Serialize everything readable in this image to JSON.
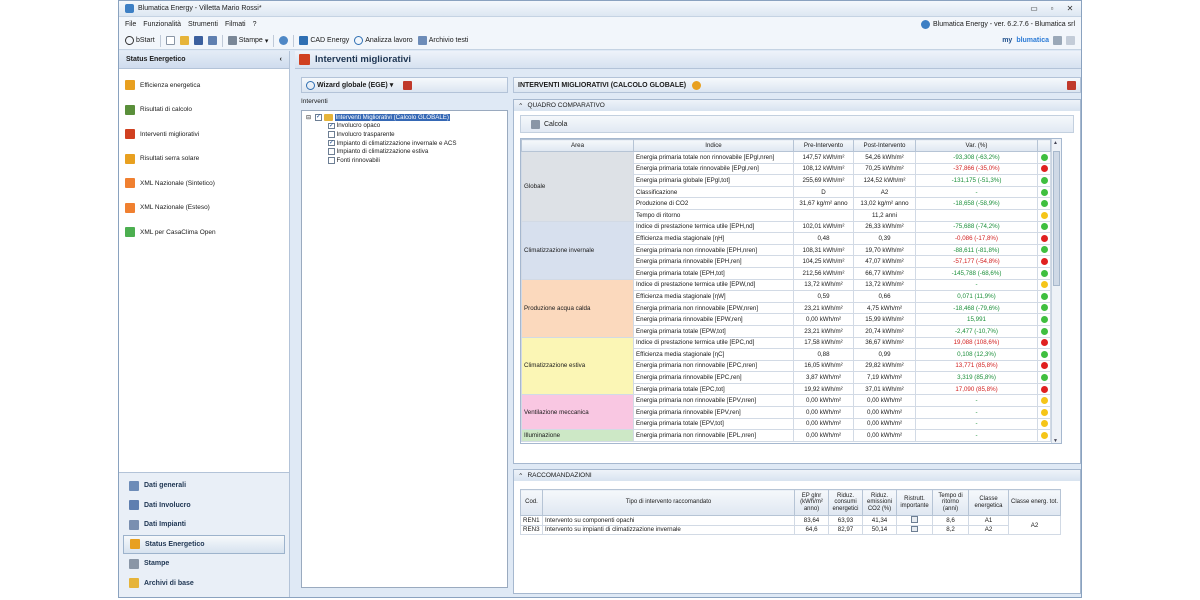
{
  "app": {
    "title": "Blumatica Energy - Villetta Mario Rossi*",
    "version": "Blumatica Energy - ver. 6.2.7.6 - Blumatica srl",
    "menu": [
      "File",
      "Funzionalità",
      "Strumenti",
      "Filmati",
      "?"
    ],
    "toolbar": {
      "bstart": "bStart",
      "stampe": "Stampe",
      "cad": "CAD Energy",
      "analizza": "Analizza lavoro",
      "archivio": "Archivio testi"
    },
    "logo_my": "my",
    "logo_brand": "blumatica"
  },
  "left_panel": {
    "title": "Status Energetico",
    "pin_glyph": "‹",
    "items": [
      {
        "label": "Efficienza energetica",
        "icon_color": "#e8a020"
      },
      {
        "label": "Risultati di calcolo",
        "icon_color": "#5a8f3a"
      },
      {
        "label": "Interventi migliorativi",
        "icon_color": "#d04020"
      },
      {
        "label": "Risultati serra solare",
        "icon_color": "#e8a020"
      },
      {
        "label": "XML Nazionale (Sintetico)",
        "icon_color": "#f08030"
      },
      {
        "label": "XML Nazionale (Esteso)",
        "icon_color": "#f08030"
      },
      {
        "label": "XML per CasaClima Open",
        "icon_color": "#4caf50"
      }
    ],
    "nav": [
      {
        "label": "Dati generali",
        "active": false
      },
      {
        "label": "Dati Involucro",
        "active": false
      },
      {
        "label": "Dati Impianti",
        "active": false
      },
      {
        "label": "Status Energetico",
        "active": true
      },
      {
        "label": "Stampe",
        "active": false
      },
      {
        "label": "Archivi di base",
        "active": false
      }
    ]
  },
  "main": {
    "title": "Interventi migliorativi",
    "wizard_label": "Wizard globale (EGE)",
    "tree_label": "Interventi",
    "tree": [
      {
        "label": "Interventi Migliorativi (Calcolo GLOBALE)",
        "level": 0,
        "checked": true,
        "selected": true
      },
      {
        "label": "Involucro opaco",
        "level": 1,
        "checked": true,
        "selected": false
      },
      {
        "label": "Involucro trasparente",
        "level": 1,
        "checked": false,
        "selected": false
      },
      {
        "label": "Impianto di climatizzazione invernale e ACS",
        "level": 1,
        "checked": true,
        "selected": false
      },
      {
        "label": "Impianto di climatizzazione estiva",
        "level": 1,
        "checked": false,
        "selected": false
      },
      {
        "label": "Fonti rinnovabili",
        "level": 1,
        "checked": false,
        "selected": false
      }
    ],
    "right_title": "INTERVENTI MIGLIORATIVI (CALCOLO GLOBALE)",
    "section1": "QUADRO COMPARATIVO",
    "calcola": "Calcola",
    "columns": [
      "Area",
      "Indice",
      "Pre-Intervento",
      "Post-Intervento",
      "Var. (%)"
    ],
    "colors": {
      "green": "#3fbf3f",
      "red": "#e02020",
      "yellow": "#f5c518",
      "positive": "#1b8f3a",
      "negative": "#d11e1e"
    },
    "groups": [
      {
        "area": "Globale",
        "bg": "#dde1e6",
        "rows": [
          {
            "index": "Energia primaria totale non rinnovabile [EPgl,nren]",
            "pre": "147,57 kWh/m²",
            "post": "54,26 kWh/m²",
            "var": "-93,308 (-63,2%)",
            "tone": "pos",
            "dot": "green"
          },
          {
            "index": "Energia primaria totale rinnovabile [EPgl,ren]",
            "pre": "108,12 kWh/m²",
            "post": "70,25 kWh/m²",
            "var": "-37,866 (-35,0%)",
            "tone": "neg",
            "dot": "red"
          },
          {
            "index": "Energia primaria globale [EPgl,tot]",
            "pre": "255,69 kWh/m²",
            "post": "124,52 kWh/m²",
            "var": "-131,175 (-51,3%)",
            "tone": "pos",
            "dot": "green"
          },
          {
            "index": "Classificazione",
            "pre": "D",
            "post": "A2",
            "var": "-",
            "tone": "pos",
            "dot": "green"
          },
          {
            "index": "Produzione di CO2",
            "pre": "31,67 kg/m² anno",
            "post": "13,02 kg/m² anno",
            "var": "-18,658 (-58,9%)",
            "tone": "pos",
            "dot": "green"
          },
          {
            "index": "Tempo di ritorno",
            "pre": "",
            "post": "11,2 anni",
            "var": "",
            "tone": "pos",
            "dot": "yellow"
          }
        ]
      },
      {
        "area": "Climatizzazione invernale",
        "bg": "#d7e0ee",
        "rows": [
          {
            "index": "Indice di prestazione termica utile [EPH,nd]",
            "pre": "102,01 kWh/m²",
            "post": "26,33 kWh/m²",
            "var": "-75,688 (-74,2%)",
            "tone": "pos",
            "dot": "green"
          },
          {
            "index": "Efficienza media stagionale [ηH]",
            "pre": "0,48",
            "post": "0,39",
            "var": "-0,086 (-17,8%)",
            "tone": "neg",
            "dot": "red"
          },
          {
            "index": "Energia primaria non rinnovabile [EPH,nren]",
            "pre": "108,31 kWh/m²",
            "post": "19,70 kWh/m²",
            "var": "-88,611 (-81,8%)",
            "tone": "pos",
            "dot": "green"
          },
          {
            "index": "Energia primaria rinnovabile [EPH,ren]",
            "pre": "104,25 kWh/m²",
            "post": "47,07 kWh/m²",
            "var": "-57,177 (-54,8%)",
            "tone": "neg",
            "dot": "red"
          },
          {
            "index": "Energia primaria totale [EPH,tot]",
            "pre": "212,56 kWh/m²",
            "post": "66,77 kWh/m²",
            "var": "-145,788 (-68,6%)",
            "tone": "pos",
            "dot": "green"
          }
        ]
      },
      {
        "area": "Produzione acqua calda",
        "bg": "#fbd9bd",
        "rows": [
          {
            "index": "Indice di prestazione termica utile [EPW,nd]",
            "pre": "13,72 kWh/m²",
            "post": "13,72 kWh/m²",
            "var": "-",
            "tone": "pos",
            "dot": "yellow"
          },
          {
            "index": "Efficienza media stagionale [ηW]",
            "pre": "0,59",
            "post": "0,66",
            "var": "0,071 (11,9%)",
            "tone": "pos",
            "dot": "green"
          },
          {
            "index": "Energia primaria non rinnovabile [EPW,nren]",
            "pre": "23,21 kWh/m²",
            "post": "4,75 kWh/m²",
            "var": "-18,468 (-79,6%)",
            "tone": "pos",
            "dot": "green"
          },
          {
            "index": "Energia primaria rinnovabile [EPW,ren]",
            "pre": "0,00 kWh/m²",
            "post": "15,99 kWh/m²",
            "var": "15,991",
            "tone": "pos",
            "dot": "green"
          },
          {
            "index": "Energia primaria totale [EPW,tot]",
            "pre": "23,21 kWh/m²",
            "post": "20,74 kWh/m²",
            "var": "-2,477 (-10,7%)",
            "tone": "pos",
            "dot": "green"
          }
        ]
      },
      {
        "area": "Climatizzazione estiva",
        "bg": "#fbf6b5",
        "rows": [
          {
            "index": "Indice di prestazione termica utile [EPC,nd]",
            "pre": "17,58 kWh/m²",
            "post": "36,67 kWh/m²",
            "var": "19,088 (108,6%)",
            "tone": "neg",
            "dot": "red"
          },
          {
            "index": "Efficienza media stagionale [ηC]",
            "pre": "0,88",
            "post": "0,99",
            "var": "0,108 (12,3%)",
            "tone": "pos",
            "dot": "green"
          },
          {
            "index": "Energia primaria non rinnovabile [EPC,nren]",
            "pre": "16,05 kWh/m²",
            "post": "29,82 kWh/m²",
            "var": "13,771 (85,8%)",
            "tone": "neg",
            "dot": "red"
          },
          {
            "index": "Energia primaria rinnovabile [EPC,ren]",
            "pre": "3,87 kWh/m²",
            "post": "7,19 kWh/m²",
            "var": "3,319 (85,8%)",
            "tone": "pos",
            "dot": "green"
          },
          {
            "index": "Energia primaria totale [EPC,tot]",
            "pre": "19,92 kWh/m²",
            "post": "37,01 kWh/m²",
            "var": "17,090 (85,8%)",
            "tone": "neg",
            "dot": "red"
          }
        ]
      },
      {
        "area": "Ventilazione meccanica",
        "bg": "#f9c7e2",
        "rows": [
          {
            "index": "Energia primaria non rinnovabile [EPV,nren]",
            "pre": "0,00 kWh/m²",
            "post": "0,00 kWh/m²",
            "var": "-",
            "tone": "pos",
            "dot": "yellow"
          },
          {
            "index": "Energia primaria rinnovabile [EPV,ren]",
            "pre": "0,00 kWh/m²",
            "post": "0,00 kWh/m²",
            "var": "-",
            "tone": "pos",
            "dot": "yellow"
          },
          {
            "index": "Energia primaria totale [EPV,tot]",
            "pre": "0,00 kWh/m²",
            "post": "0,00 kWh/m²",
            "var": "-",
            "tone": "pos",
            "dot": "yellow"
          }
        ]
      },
      {
        "area": "Illuminazione",
        "bg": "#cde8c6",
        "rows": [
          {
            "index": "Energia primaria non rinnovabile [EPL,nren]",
            "pre": "0,00 kWh/m²",
            "post": "0,00 kWh/m²",
            "var": "-",
            "tone": "pos",
            "dot": "yellow"
          }
        ]
      }
    ],
    "section2": "RACCOMANDAZIONI",
    "rec_columns": [
      "Cod.",
      "Tipo di intervento raccomandato",
      "EP glnr (kWh/m² anno)",
      "Riduz. consumi energetici",
      "Riduz. emissioni CO2 (%)",
      "Ristrutt. importante",
      "Tempo di ritorno (anni)",
      "Classe energetica",
      "Classe energ. tot."
    ],
    "recommendations": [
      {
        "cod": "REN1",
        "tipo": "Intervento su componenti opachi",
        "ep": "83,64",
        "riduz_cons": "63,93",
        "riduz_co2": "41,34",
        "ritorno": "8,6",
        "classe": "A1"
      },
      {
        "cod": "REN3",
        "tipo": "Intervento su impianti di climatizzazione invernale",
        "ep": "64,6",
        "riduz_cons": "82,97",
        "riduz_co2": "50,14",
        "ritorno": "8,2",
        "classe": "A2"
      }
    ],
    "classe_tot": "A2"
  }
}
